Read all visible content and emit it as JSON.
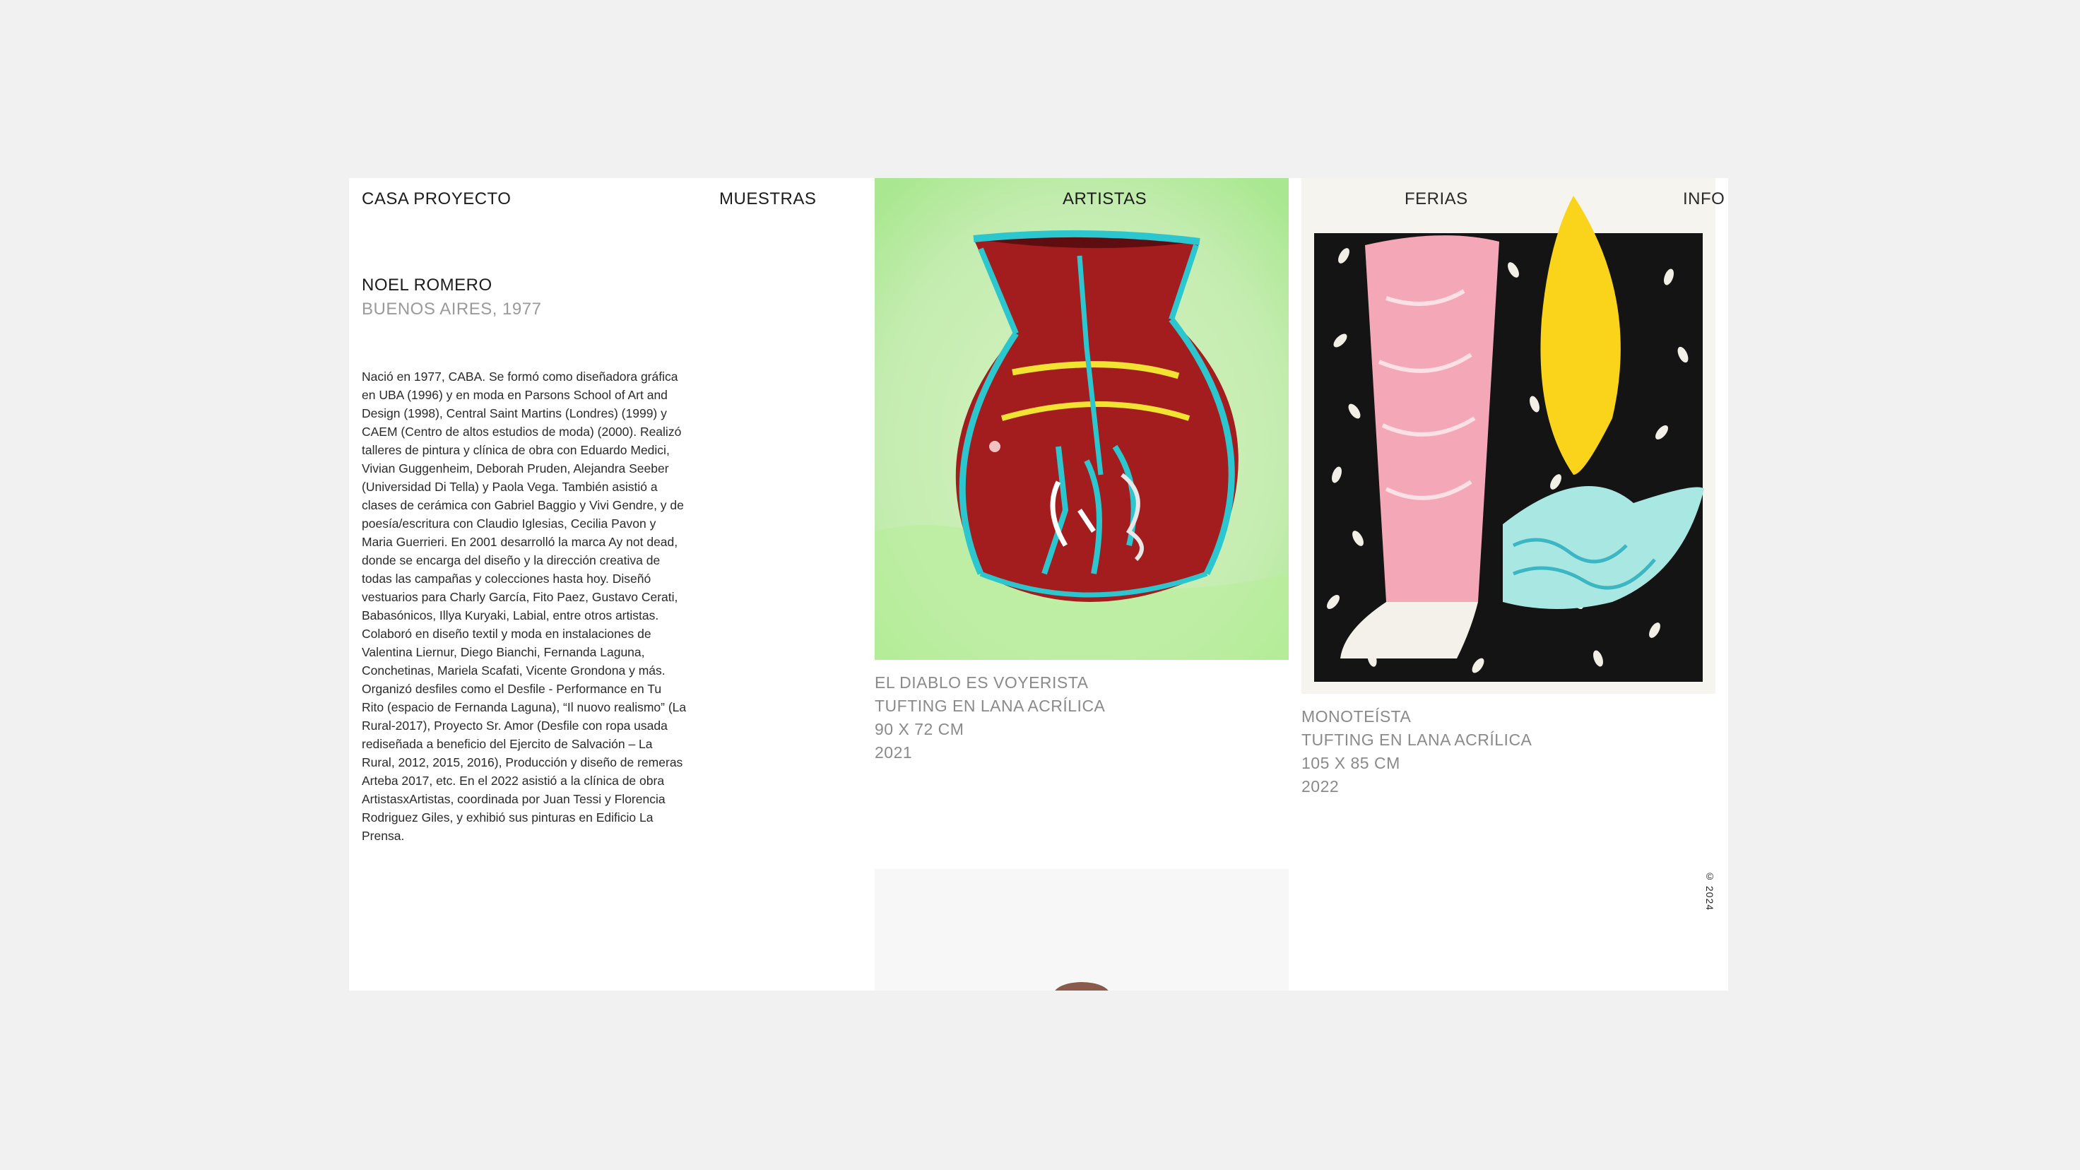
{
  "nav": {
    "brand": "CASA PROYECTO",
    "muestras": "MUESTRAS",
    "artistas": "ARTISTAS",
    "ferias": "FERIAS",
    "info": "INFO"
  },
  "artist": {
    "name": "NOEL ROMERO",
    "origin": "BUENOS AIRES, 1977",
    "bio": "Nació en 1977, CABA. Se formó como diseñadora gráfica en UBA (1996) y en moda en Parsons School of Art and Design (1998), Central Saint Martins (Londres) (1999) y CAEM (Centro de altos estudios de moda) (2000). Realizó talleres de pintura y clínica de obra con Eduardo Medici, Vivian Guggenheim, Deborah Pruden, Alejandra Seeber (Universidad Di Tella) y Paola Vega. También asistió a clases de cerámica con Gabriel Baggio y Vivi Gendre, y de poesía/escritura con Claudio Iglesias, Cecilia Pavon y Maria Guerrieri. En 2001 desarrolló la marca Ay not dead, donde se encarga del diseño y la dirección creativa de todas las campañas y colecciones hasta hoy. Diseñó vestuarios para Charly García, Fito Paez, Gustavo Cerati, Babasónicos, Illya Kuryaki, Labial, entre otros artistas. Colaboró en diseño textil y moda en instalaciones de Valentina Liernur, Diego Bianchi, Fernanda Laguna, Conchetinas, Mariela Scafati, Vicente Grondona y más. Organizó desfiles como el Desfile - Performance en Tu Rito (espacio de Fernanda Laguna), “Il nuovo realismo” (La Rural-2017), Proyecto Sr. Amor (Desfile con ropa usada rediseñada a beneficio del Ejercito de Salvación – La Rural, 2012, 2015, 2016), Producción y diseño de remeras Arteba 2017, etc. En el 2022 asistió a la clínica de obra ArtistasxArtistas, coordinada por Juan Tessi y Florencia Rodriguez Giles, y exhibió sus pinturas en Edificio La Prensa."
  },
  "works": [
    {
      "title": "EL DIABLO ES VOYERISTA",
      "technique": "TUFTING EN LANA ACRÍLICA",
      "size": "90 X 72 CM",
      "year": "2021"
    },
    {
      "title": "MONOTEÍSTA",
      "technique": "TUFTING EN LANA ACRÍLICA",
      "size": "105 X 85 CM",
      "year": "2022"
    }
  ],
  "side": {
    "copyright": "© 2024"
  },
  "colors": {
    "background": "#f1f1f1",
    "page": "#ffffff",
    "text": "#1c1c1c",
    "muted": "#8a8a8a"
  }
}
